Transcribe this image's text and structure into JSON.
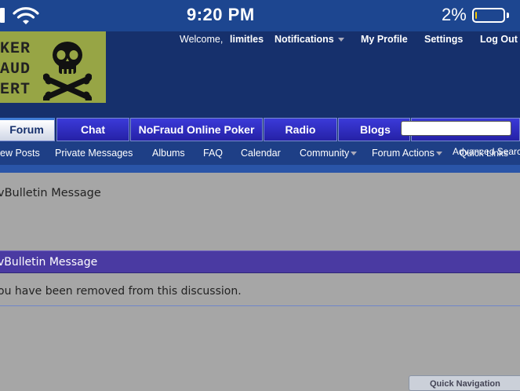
{
  "status_bar": {
    "time": "9:20 PM",
    "battery_percent": "2%",
    "battery_level": 0.02,
    "icons": [
      "signal-icon",
      "wifi-icon",
      "battery-icon"
    ]
  },
  "logo": {
    "text": "KER\nAUD\nERT",
    "icon": "skull-crossbones-icon"
  },
  "top_links": {
    "welcome": "Welcome,",
    "username": "limitles",
    "notifications": "Notifications",
    "my_profile": "My Profile",
    "settings": "Settings",
    "log_out": "Log Out"
  },
  "nav_tabs": [
    {
      "label": "Forum",
      "active": true
    },
    {
      "label": "Chat",
      "active": false
    },
    {
      "label": "NoFraud Online Poker",
      "active": false
    },
    {
      "label": "Radio",
      "active": false
    },
    {
      "label": "Blogs",
      "active": false
    }
  ],
  "search": {
    "placeholder": ""
  },
  "sub_nav": {
    "new_posts": "ew Posts",
    "private_messages": "Private Messages",
    "albums": "Albums",
    "faq": "FAQ",
    "calendar": "Calendar",
    "community": "Community",
    "forum_actions": "Forum Actions",
    "quick_links": "Quick Links",
    "advanced_search": "Advanced Search"
  },
  "message": {
    "title": "vBulletin Message",
    "block_title": "vBulletin Message",
    "body": "ou have been removed from this discussion."
  },
  "footer": {
    "quick_nav": "Quick Navigation"
  },
  "colors": {
    "status_bar": "#1d4690",
    "header": "#16306c",
    "tab": "#2521a6",
    "block_head": "#4a3aa2",
    "page_bg": "#a6a6a6"
  }
}
